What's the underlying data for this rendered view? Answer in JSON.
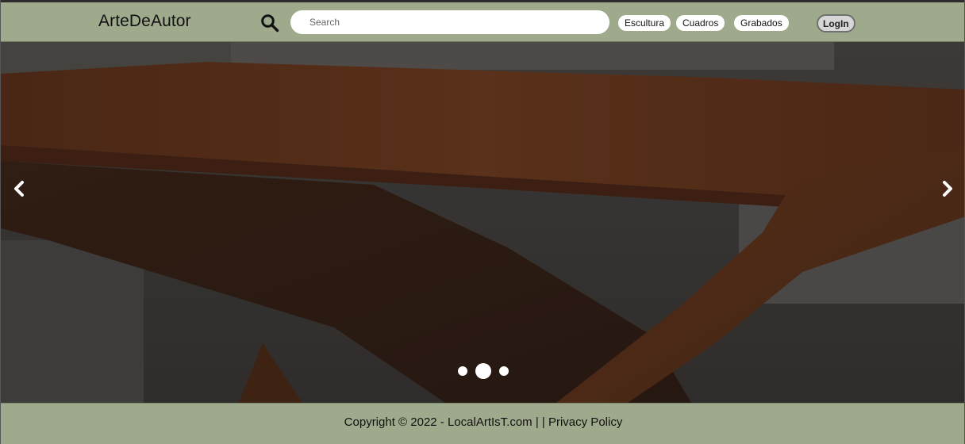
{
  "header": {
    "brand": "ArteDeAutor",
    "search_placeholder": "Search",
    "search_value": "",
    "categories": [
      "Escultura",
      "Cuadros",
      "Grabados"
    ],
    "login_label": "LogIn",
    "background_color": "#9faa8d"
  },
  "carousel": {
    "prev_icon": "chevron-left-icon",
    "next_icon": "chevron-right-icon",
    "slide_count": 3,
    "active_slide": 2,
    "slide_image": "wooden-table-photo"
  },
  "footer": {
    "copyright": "Copyright © 2022 - ",
    "site_link": "LocalArtIsT.com",
    "separator": " | | ",
    "privacy_link": "Privacy Policy",
    "background_color": "#9faa8d"
  }
}
